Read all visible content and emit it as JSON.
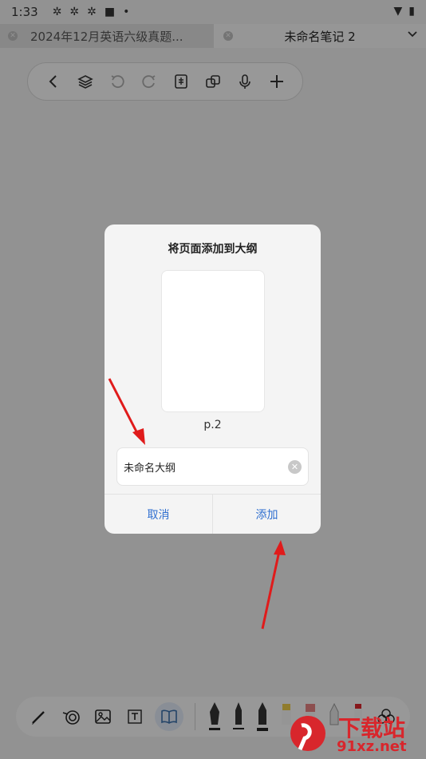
{
  "status_bar": {
    "time": "1:33"
  },
  "tabs": [
    {
      "label": "2024年12月英语六级真题..."
    },
    {
      "label": "未命名笔记 2"
    }
  ],
  "toolbar": {
    "icons": [
      "back-icon",
      "layers-icon",
      "undo-icon",
      "redo-icon",
      "page-icon",
      "copy-icon",
      "mic-icon",
      "add-icon"
    ]
  },
  "dialog": {
    "title": "将页面添加到大纲",
    "page_label": "p.2",
    "name_value": "未命名大纲",
    "cancel_label": "取消",
    "add_label": "添加"
  },
  "watermark": {
    "line1": "下载站",
    "line2": "91xz.net"
  },
  "colors": {
    "accent": "#2f6fd0",
    "arrow": "#e01b1b"
  }
}
